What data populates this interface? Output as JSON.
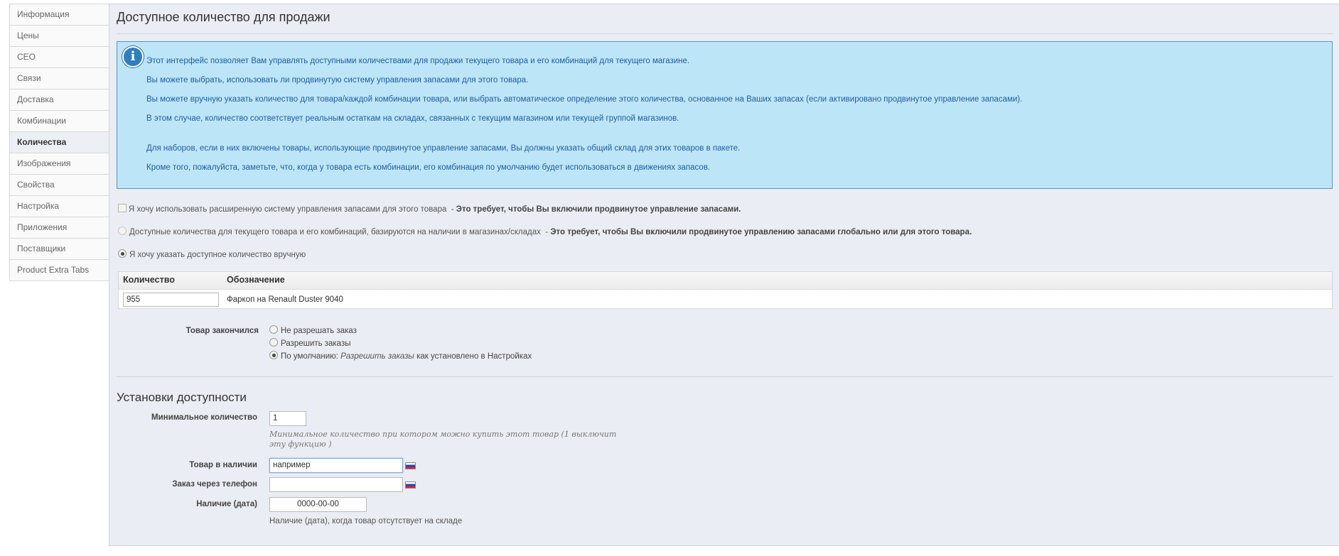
{
  "sidebar": {
    "items": [
      {
        "label": "Информация"
      },
      {
        "label": "Цены"
      },
      {
        "label": "СЕО"
      },
      {
        "label": "Связи"
      },
      {
        "label": "Доставка"
      },
      {
        "label": "Комбинации"
      },
      {
        "label": "Количества",
        "active": true
      },
      {
        "label": "Изображения"
      },
      {
        "label": "Свойства"
      },
      {
        "label": "Настройка"
      },
      {
        "label": "Приложения"
      },
      {
        "label": "Поставщики"
      },
      {
        "label": "Product Extra Tabs"
      }
    ]
  },
  "main": {
    "title": "Доступное количество для продажи",
    "info": {
      "icon": "info-icon",
      "lines": [
        "Этот интерфейс позволяет Вам управлять доступными количествами для продажи текущего товара и его комбинаций для текущего магазине.",
        "Вы можете выбрать, использовать ли продвинутую систему управления запасами для этого товара.",
        "Вы можете вручную указать количество для товара/каждой комбинации товара, или выбрать автоматическое определение этого количества, основанное на Ваших запасах (если активировано продвинутое управление запасами).",
        "В этом случае, количество соответствует реальным остаткам на складах, связанных с текущим магазином или текущей группой магазинов.",
        "Для наборов, если в них включены товары, использующие продвинутое управление запасами, Вы должны указать общий склад для этих товаров в пакете.",
        "Кроме того, пожалуйста, заметьте, что, когда у товара есть комбинации, его комбинация по умолчанию будет использоваться в движениях запасов."
      ]
    },
    "options": {
      "advanced_stock_label": "Я хочу использовать расширенную систему управления запасами для этого товара",
      "advanced_stock_note": "Это требует, чтобы Вы включили продвинутое управление запасами.",
      "based_on_stock_label": "Доступные количества для текущего товара и его комбинаций, базируются на наличии в магазинах/складах",
      "based_on_stock_note": "Это требует, чтобы Вы включили продвинутое управлению запасами глобально или для этого товара.",
      "manual_label": "Я хочу указать доступное количество вручную"
    },
    "quantity_table": {
      "col_qty": "Количество",
      "col_name": "Обозначение",
      "rows": [
        {
          "qty": "955",
          "name": "Фаркоп на Renault Duster 9040"
        }
      ]
    },
    "out_of_stock": {
      "label": "Товар закончился",
      "options": [
        {
          "label": "Не разрешать заказ",
          "selected": false
        },
        {
          "label": "Разрешить заказы",
          "selected": false
        },
        {
          "prefix": "По умолчанию:",
          "italic": "Разрешить заказы",
          "suffix": "как установлено в Настройках",
          "selected": true
        }
      ]
    },
    "availability": {
      "title": "Установки доступности",
      "min_qty_label": "Минимальное количество",
      "min_qty_value": "1",
      "min_qty_hint_1": "Минимальное количество при котором можно купить этот товар (1 выключит",
      "min_qty_hint_2": "эту функцию )",
      "in_stock_label": "Товар в наличии",
      "in_stock_value": "например",
      "phone_order_label": "Заказ через телефон",
      "phone_order_value": "",
      "date_label": "Наличие (дата)",
      "date_value": "0000-00-00",
      "date_hint": "Наличие (дата), когда товар отсутствует на складе",
      "flag_icon": "russian-flag-icon"
    }
  }
}
